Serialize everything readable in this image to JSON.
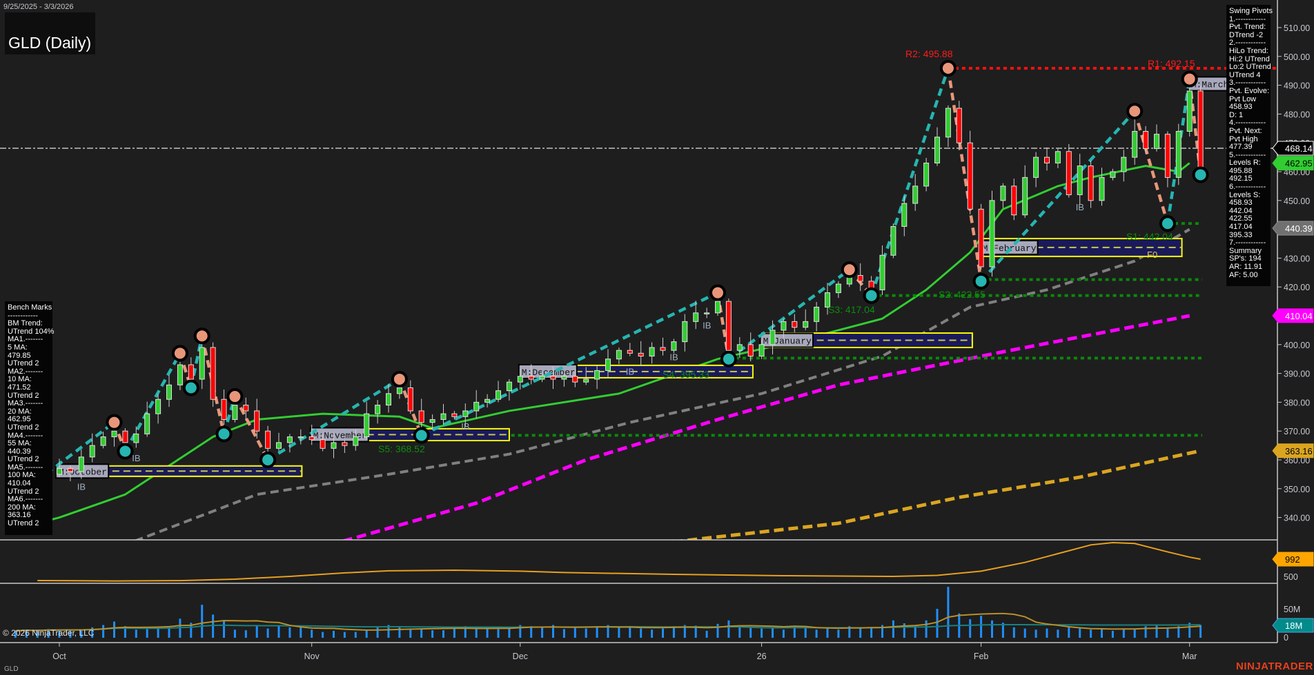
{
  "header": {
    "date_range": "9/25/2025 - 3/3/2026",
    "title": "GLD (Daily)"
  },
  "footer": {
    "copyright": "© 2026 NinjaTrader, LLC",
    "symbol": "GLD",
    "brand": "NINJATRADER"
  },
  "bench_marks": {
    "lines": [
      "Bench Marks",
      "------------",
      "BM Trend:",
      "UTrend 104%",
      "MA1.-------",
      "5 MA:",
      "479.85",
      "UTrend 2",
      "MA2.-------",
      "10 MA:",
      "471.52",
      "UTrend 2",
      "MA3.-------",
      "20 MA:",
      "462.95",
      "UTrend 2",
      "MA4.-------",
      "55 MA:",
      "440.39",
      "UTrend 2",
      "MA5.-------",
      "100 MA:",
      "410.04",
      "UTrend 2",
      "MA6.-------",
      "200 MA:",
      "363.16",
      "UTrend 2"
    ]
  },
  "swing_pivots": {
    "lines": [
      "Swing Pivots",
      "1.------------",
      "Pvt. Trend:",
      "DTrend -2",
      "2.------------",
      "HiLo Trend:",
      "Hi:2 UTrend",
      "Lo:2 UTrend",
      "UTrend 4",
      "3.------------",
      "Pvt. Evolve:",
      "Pvt Low",
      "458.93",
      "D: 1",
      "4.------------",
      "Pvt. Next:",
      "Pvt High",
      "477.39",
      "5.------------",
      "Levels R:",
      "495.88",
      "492.15",
      "6.------------",
      "Levels S:",
      "458.93",
      "442.04",
      "422.55",
      "417.04",
      "395.33",
      "7.------------",
      "Summary",
      "SP's: 194",
      "AR: 11.91",
      "AF: 5.00"
    ]
  },
  "colors": {
    "up": "#32cd32",
    "down": "#ff0000",
    "ma20": "#32cd32",
    "ma55": "#808080",
    "ma100": "#ff00ff",
    "ma200": "#daa520",
    "swing_up": "#26b5b0",
    "swing_down": "#e8967a",
    "volume": "#1e90ff",
    "indicator": "#e8a020",
    "month_box": "#ffff00",
    "month_fill": "#1a1a5a"
  },
  "chart_data": {
    "type": "candlestick",
    "title": "GLD (Daily)",
    "x_ticks": [
      {
        "label": "Oct",
        "bar": 4
      },
      {
        "label": "Nov",
        "bar": 27
      },
      {
        "label": "Dec",
        "bar": 46
      },
      {
        "label": "26",
        "bar": 68
      },
      {
        "label": "Feb",
        "bar": 88
      },
      {
        "label": "Mar",
        "bar": 107
      }
    ],
    "y_ticks": [
      "510.00",
      "500.00",
      "490.00",
      "480.00",
      "470.00",
      "460.00",
      "450.00",
      "440.00",
      "430.00",
      "420.00",
      "410.00",
      "400.00",
      "390.00",
      "380.00",
      "370.00",
      "360.00",
      "350.00",
      "340.00"
    ],
    "ylim": [
      335,
      513
    ],
    "close": [
      345,
      347,
      352,
      355,
      357,
      356,
      361,
      365,
      368,
      370,
      366,
      369,
      376,
      381,
      386,
      393,
      388,
      399,
      381,
      374,
      379,
      377,
      370,
      364,
      366,
      368,
      368,
      367,
      364,
      366,
      365,
      368,
      376,
      379,
      383,
      385,
      377,
      373,
      374,
      376,
      375,
      377,
      380,
      381,
      384,
      387,
      389,
      388,
      389,
      388,
      389,
      387,
      388,
      391,
      395,
      398,
      397,
      396,
      399,
      398,
      401,
      408,
      411,
      411,
      415,
      398,
      400,
      396,
      400,
      405,
      408,
      406,
      408,
      413,
      418,
      421,
      424,
      422,
      419,
      431,
      441,
      449,
      455,
      463,
      472,
      482,
      470,
      447,
      427,
      450,
      455,
      445,
      458,
      465,
      463,
      467,
      452,
      462,
      450,
      458,
      460,
      465,
      474,
      468,
      473,
      458,
      474,
      488,
      460
    ],
    "moving_averages": [
      {
        "name": "20 MA",
        "value": "462.95",
        "points": [
          [
            2,
            338
          ],
          [
            4,
            340
          ],
          [
            10,
            348
          ],
          [
            18,
            368
          ],
          [
            22,
            374
          ],
          [
            28,
            376
          ],
          [
            35,
            375
          ],
          [
            38,
            371
          ],
          [
            45,
            377
          ],
          [
            55,
            383
          ],
          [
            64,
            395
          ],
          [
            72,
            402
          ],
          [
            79,
            409
          ],
          [
            83,
            419
          ],
          [
            87,
            432
          ],
          [
            90,
            447
          ],
          [
            95,
            455
          ],
          [
            98,
            458
          ],
          [
            103,
            462
          ],
          [
            106,
            460
          ],
          [
            107,
            463
          ]
        ]
      },
      {
        "name": "55 MA",
        "value": "440.39",
        "points": [
          [
            5,
            328
          ],
          [
            11,
            332
          ],
          [
            22,
            348
          ],
          [
            34,
            355
          ],
          [
            45,
            362
          ],
          [
            56,
            373
          ],
          [
            68,
            383
          ],
          [
            79,
            396
          ],
          [
            87,
            413
          ],
          [
            94,
            419
          ],
          [
            102,
            429
          ],
          [
            107,
            440
          ]
        ]
      },
      {
        "name": "100 MA",
        "value": "410.04",
        "points": [
          [
            26,
            328
          ],
          [
            31,
            333
          ],
          [
            42,
            345
          ],
          [
            52,
            360
          ],
          [
            64,
            374
          ],
          [
            75,
            386
          ],
          [
            90,
            397.5
          ],
          [
            107,
            410
          ]
        ]
      },
      {
        "name": "200 MA",
        "value": "363.16",
        "points": [
          [
            56,
            330
          ],
          [
            61,
            332
          ],
          [
            75,
            338
          ],
          [
            86,
            347
          ],
          [
            97,
            354
          ],
          [
            108,
            363.16
          ]
        ]
      }
    ],
    "reference_line": {
      "value": "468.14"
    },
    "price_tags": [
      {
        "value": "468.14",
        "price": 468.14,
        "bg": "#000000",
        "fg": "#ffffff",
        "border": "#ffffff"
      },
      {
        "value": "462.95",
        "price": 462.95,
        "bg": "#32cd32",
        "fg": "#000000",
        "border": "#32cd32"
      },
      {
        "value": "440.39",
        "price": 440.39,
        "bg": "#707070",
        "fg": "#ffffff",
        "border": "#909090"
      },
      {
        "value": "410.04",
        "price": 410.04,
        "bg": "#ff00ff",
        "fg": "#ffffff",
        "border": "#ff00ff"
      },
      {
        "value": "363.16",
        "price": 363.16,
        "bg": "#daa520",
        "fg": "#000000",
        "border": "#daa520"
      }
    ],
    "pivots": [
      [
        1,
        350,
        "L"
      ],
      [
        9,
        373,
        "H"
      ],
      [
        10,
        363,
        "L"
      ],
      [
        15,
        397,
        "H"
      ],
      [
        16,
        385,
        "L"
      ],
      [
        17,
        403,
        "H"
      ],
      [
        19,
        369,
        "L"
      ],
      [
        20,
        382,
        "H"
      ],
      [
        23,
        360,
        "L"
      ],
      [
        35,
        388,
        "H"
      ],
      [
        37,
        368.5,
        "L"
      ],
      [
        64,
        418,
        "H"
      ],
      [
        65,
        395,
        "L"
      ],
      [
        76,
        426,
        "H"
      ],
      [
        78,
        417,
        "L"
      ],
      [
        85,
        495.88,
        "H"
      ],
      [
        88,
        422,
        "L"
      ],
      [
        102,
        481,
        "H"
      ],
      [
        105,
        442,
        "L"
      ],
      [
        107,
        492.15,
        "H"
      ],
      [
        108,
        458.93,
        "L"
      ]
    ],
    "levels": [
      {
        "label": "R2: 495.88",
        "price": 495.88,
        "from_bar": 85,
        "kind": "resistance"
      },
      {
        "label": "R1: 492.15",
        "price": 492.15,
        "from_bar": 107,
        "kind": "resistance"
      },
      {
        "label": "S1: 442.04",
        "price": 442.04,
        "from_bar": 105,
        "kind": "support"
      },
      {
        "label": "S2: 422.55",
        "price": 422.55,
        "from_bar": 88,
        "kind": "support"
      },
      {
        "label": "S3: 417.04",
        "price": 417.04,
        "from_bar": 78,
        "kind": "support"
      },
      {
        "label": "S4: 395.33",
        "price": 395.33,
        "from_bar": 65,
        "kind": "support"
      },
      {
        "label": "S5: 368.52",
        "price": 368.52,
        "from_bar": 37,
        "kind": "support"
      }
    ],
    "monthly_boxes": [
      {
        "label": "M:October",
        "start_bar": 3.8,
        "end_bar": 26.1,
        "high": 357.9,
        "low": 354.3
      },
      {
        "label": "M:November",
        "start_bar": 27,
        "end_bar": 45,
        "high": 370.8,
        "low": 366.7
      },
      {
        "label": "M:December",
        "start_bar": 46,
        "end_bar": 67.2,
        "high": 392.8,
        "low": 388.5
      },
      {
        "label": "M:January",
        "start_bar": 68,
        "end_bar": 87.2,
        "high": 404,
        "low": 399
      },
      {
        "label": "M:February",
        "start_bar": 88,
        "end_bar": 106.3,
        "high": 436.8,
        "low": 430.6
      },
      {
        "label": "M:March",
        "start_bar": 107,
        "end_bar": 108,
        "high": 492,
        "low": 489
      }
    ],
    "annotations": [
      {
        "text": "IB",
        "bar": 11,
        "price": 361
      },
      {
        "text": "IB",
        "bar": 6,
        "price": 351
      },
      {
        "text": "IB",
        "bar": 41,
        "price": 372
      },
      {
        "text": "IB",
        "bar": 56,
        "price": 391
      },
      {
        "text": "IB",
        "bar": 60,
        "price": 396
      },
      {
        "text": "IB",
        "bar": 63,
        "price": 407
      },
      {
        "text": "IB",
        "bar": 97,
        "price": 448
      },
      {
        "text": "F0",
        "bar": 103.5,
        "price": 431.5
      }
    ],
    "indicator": {
      "tick": "500",
      "last_label": "992",
      "ylim": [
        300,
        1500
      ],
      "points": [
        [
          2,
          382
        ],
        [
          9,
          370
        ],
        [
          15,
          380
        ],
        [
          20,
          420
        ],
        [
          25,
          500
        ],
        [
          30,
          600
        ],
        [
          34,
          660
        ],
        [
          40,
          677
        ],
        [
          46,
          650
        ],
        [
          50,
          610
        ],
        [
          60,
          560
        ],
        [
          70,
          520
        ],
        [
          80,
          500
        ],
        [
          84,
          530
        ],
        [
          88,
          650
        ],
        [
          92,
          900
        ],
        [
          95,
          1150
        ],
        [
          98,
          1400
        ],
        [
          100,
          1465
        ],
        [
          102,
          1440
        ],
        [
          105,
          1200
        ],
        [
          107,
          1050
        ],
        [
          108,
          992
        ]
      ]
    },
    "volume": {
      "unit": "M",
      "ticks": [
        "50M",
        "0"
      ],
      "last_label": "18M",
      "values": [
        12,
        14,
        12,
        15,
        14,
        14,
        14,
        18,
        22,
        28,
        20,
        14,
        15,
        17,
        20,
        33,
        26,
        57,
        40,
        29,
        14,
        13,
        22,
        16,
        20,
        18,
        18,
        14,
        10,
        12,
        10,
        10,
        14,
        19,
        22,
        18,
        14,
        16,
        13,
        13,
        16,
        20,
        18,
        19,
        15,
        16,
        22,
        20,
        18,
        22,
        15,
        17,
        16,
        20,
        22,
        18,
        18,
        16,
        14,
        16,
        20,
        22,
        21,
        12,
        24,
        30,
        20,
        18,
        16,
        18,
        14,
        20,
        20,
        14,
        16,
        14,
        20,
        18,
        18,
        22,
        30,
        25,
        22,
        30,
        50,
        88,
        42,
        32,
        38,
        30,
        26,
        18,
        16,
        14,
        16,
        14,
        18,
        16,
        14,
        16,
        12,
        16,
        16,
        20,
        22,
        18,
        20,
        26,
        22
      ]
    }
  }
}
